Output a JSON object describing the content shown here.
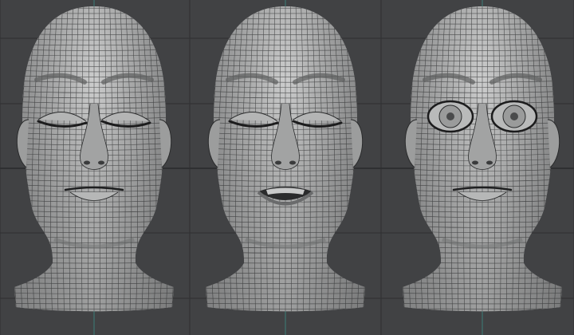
{
  "viewport": {
    "background": "#414244",
    "grid_line_color": "#2e2f31",
    "axis_color": "#3a8f86",
    "mesh_fill": "#a9aaaa",
    "wire_color": "#2a2b2c"
  },
  "models": [
    {
      "id": "head-eyes-closed-smile",
      "eyes": "closed",
      "mouth": "closed-smile"
    },
    {
      "id": "head-eyes-closed-open-mouth",
      "eyes": "closed",
      "mouth": "open-smile"
    },
    {
      "id": "head-eyes-open-smile",
      "eyes": "open",
      "mouth": "closed-smile"
    }
  ]
}
